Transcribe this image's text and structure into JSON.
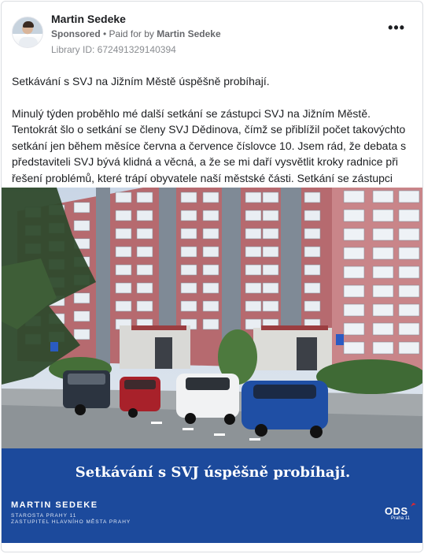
{
  "post": {
    "author": "Martin Sedeke",
    "sponsored_label": "Sponsored",
    "paid_for_prefix": " • Paid for by ",
    "paid_for_name": "Martin Sedeke",
    "library_id": "Library ID: 672491329140394",
    "more_label": "•••",
    "title_line": "Setkávání s SVJ na Jižním Městě úspěšně probíhají.",
    "body": "Minulý týden proběhlo mé další setkání se zástupci SVJ na Jižním Městě. Tentokrát šlo o setkání se členy SVJ Dědinova, čímž se přiblížil počet takovýchto setkání jen během měsíce června a července číslovce 10. Jsem rád, že debata s představiteli SVJ bývá klidná a věcná, a že se mi daří vysvětlit kroky radnice při řešení problémů, které trápí obyvatele naší městské části. Setkání se zástupci SV…"
  },
  "banner": {
    "title": "Setkávání s SVJ úspěšně probíhají.",
    "name": "MARTIN SEDEKE",
    "role1": "STAROSTA PRAHY 11",
    "role2": "ZASTUPITEL HLAVNÍHO MĚSTA PRAHY",
    "logo": "ODS",
    "logo_sub": "Praha 11"
  },
  "colors": {
    "banner_bg": "#1c4a9c",
    "logo_accent": "#e2262c"
  }
}
